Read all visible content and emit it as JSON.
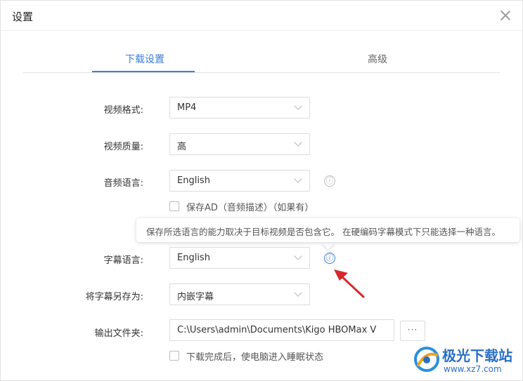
{
  "dialog": {
    "title": "设置"
  },
  "tabs": [
    {
      "label": "下载设置",
      "active": true
    },
    {
      "label": "高级",
      "active": false
    }
  ],
  "form": {
    "video_format": {
      "label": "视频格式:",
      "value": "MP4"
    },
    "video_quality": {
      "label": "视频质量:",
      "value": "高"
    },
    "audio_language": {
      "label": "音频语言:",
      "value": "English"
    },
    "save_ad": {
      "label": "保存AD（音频描述）（如果有）",
      "checked": false
    },
    "subtitle_language": {
      "label": "字幕语言:",
      "value": "English"
    },
    "save_subtitle_as": {
      "label": "将字幕另存为:",
      "value": "内嵌字幕"
    },
    "output_folder": {
      "label": "输出文件夹:",
      "value": "C:\\Users\\admin\\Documents\\Kigo HBOMax V",
      "browse_label": "···"
    },
    "sleep_after_download": {
      "label": "下载完成后，使电脑进入睡眠状态",
      "checked": false
    }
  },
  "tooltip": {
    "text": "保存所选语言的能力取决于目标视频是否包含它。 在硬编码字幕模式下只能选择一种语言。"
  },
  "icons": {
    "info": "ⓘ"
  },
  "colors": {
    "accent": "#3b7ed8",
    "arrow_red": "#d9262c"
  },
  "watermark": {
    "name": "极光下载站",
    "url": "www.xz7.com"
  }
}
